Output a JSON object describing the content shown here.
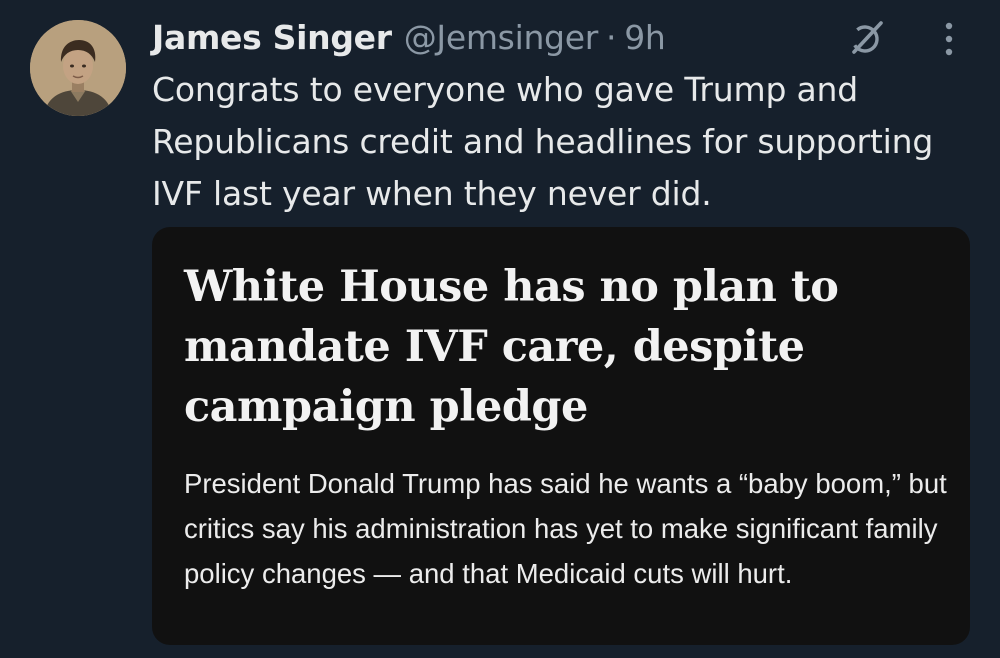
{
  "author": {
    "display_name": "James Singer",
    "handle": "@Jemsinger",
    "separator": "·",
    "time": "9h"
  },
  "tweet_text": "Congrats to everyone who gave Trump and Republicans credit and headlines for supporting IVF last year when they never did.",
  "card": {
    "headline": "White House has no plan to mandate IVF care, despite campaign pledge",
    "summary": "President Donald Trump has said he wants a “baby boom,” but critics say his administration has yet to make significant family policy changes — and that Medicaid cuts will hurt."
  },
  "icons": {
    "avatar": "profile-photo",
    "grok": "grok-icon",
    "more": "more-options-icon"
  },
  "colors": {
    "background": "#16202c",
    "primary_text": "#e7e9ea",
    "secondary_text": "#8b98a5",
    "card_background": "#111111"
  }
}
